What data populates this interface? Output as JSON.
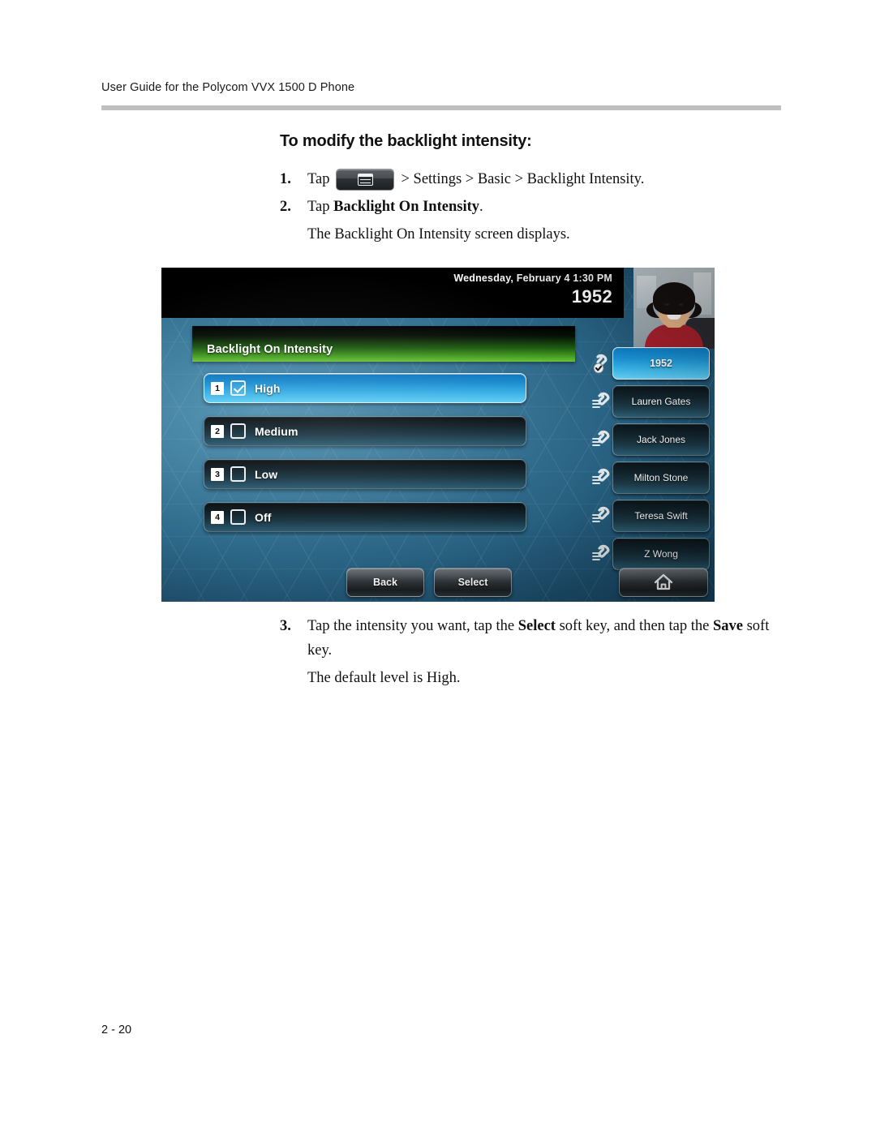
{
  "document": {
    "header_title": "User Guide for the Polycom VVX 1500 D Phone",
    "page_number": "2 - 20"
  },
  "section": {
    "heading": "To modify the backlight intensity:"
  },
  "steps": [
    {
      "number": "1.",
      "prefix": "Tap",
      "icon": "home-menu-key-icon",
      "suffix": "> Settings > Basic > Backlight Intensity."
    },
    {
      "number": "2.",
      "text_plain": "Tap ",
      "text_bold": "Backlight On Intensity",
      "text_tail": ".",
      "sub": "The Backlight On Intensity screen displays."
    },
    {
      "number": "3.",
      "part1": "Tap the intensity you want, tap the ",
      "bold1": "Select",
      "part2": " soft key, and then tap the ",
      "bold2": "Save",
      "part3": " soft key.",
      "sub": "The default level is High."
    }
  ],
  "phone_screen": {
    "status_bar": {
      "date_time": "Wednesday, February 4  1:30 PM",
      "extension": "1952"
    },
    "video_thumbnail": {
      "label": "self-view-video"
    },
    "menu_title": "Backlight On Intensity",
    "options": [
      {
        "index": "1",
        "label": "High",
        "checked": true,
        "selected": true
      },
      {
        "index": "2",
        "label": "Medium",
        "checked": false,
        "selected": false
      },
      {
        "index": "3",
        "label": "Low",
        "checked": false,
        "selected": false
      },
      {
        "index": "4",
        "label": "Off",
        "checked": false,
        "selected": false
      }
    ],
    "line_keys": [
      {
        "label": "1952",
        "active": true,
        "icon": "registered-line-icon"
      },
      {
        "label": "Lauren Gates",
        "active": false,
        "icon": "speed-dial-line-icon"
      },
      {
        "label": "Jack Jones",
        "active": false,
        "icon": "speed-dial-line-icon"
      },
      {
        "label": "Milton Stone",
        "active": false,
        "icon": "speed-dial-line-icon"
      },
      {
        "label": "Teresa Swift",
        "active": false,
        "icon": "speed-dial-line-icon"
      },
      {
        "label": "Z Wong",
        "active": false,
        "icon": "speed-dial-line-icon"
      }
    ],
    "soft_keys": {
      "back": "Back",
      "select": "Select",
      "home_icon": "home-icon"
    }
  },
  "colors": {
    "rule_gray": "#bfbfbf",
    "title_green": "#49a523",
    "selected_blue": "#1589cf",
    "screen_blue": "#2e6b8c",
    "status_black": "#000000"
  }
}
